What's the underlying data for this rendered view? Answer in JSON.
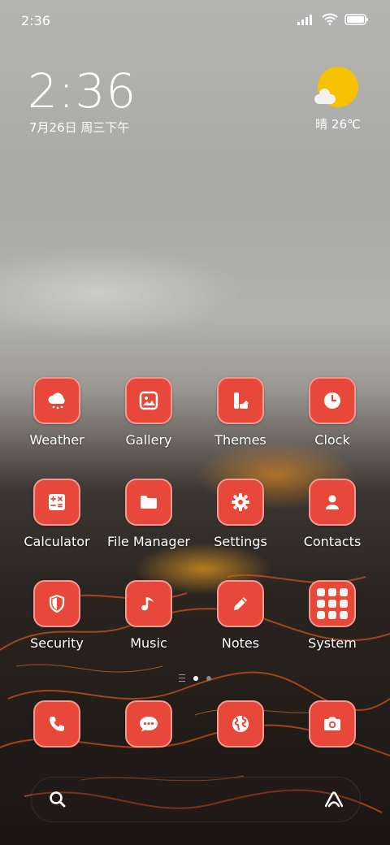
{
  "status_bar": {
    "time": "2:36",
    "icons": [
      "signal-icon",
      "wifi-icon",
      "battery-icon"
    ]
  },
  "clock_widget": {
    "time": "2:36",
    "date": "7月26日 周三下午"
  },
  "weather_widget": {
    "icon": "sun-cloud-icon",
    "text": "晴 26℃"
  },
  "colors": {
    "icon_bg": "#e8483a",
    "icon_border": "#f39a92",
    "sun": "#f6c100"
  },
  "apps": [
    {
      "label": "Weather",
      "icon": "weather-icon"
    },
    {
      "label": "Gallery",
      "icon": "gallery-icon"
    },
    {
      "label": "Themes",
      "icon": "themes-icon"
    },
    {
      "label": "Clock",
      "icon": "clock-icon"
    },
    {
      "label": "Calculator",
      "icon": "calculator-icon"
    },
    {
      "label": "File Manager",
      "icon": "folder-icon"
    },
    {
      "label": "Settings",
      "icon": "gear-icon"
    },
    {
      "label": "Contacts",
      "icon": "contact-icon"
    },
    {
      "label": "Security",
      "icon": "shield-icon"
    },
    {
      "label": "Music",
      "icon": "music-note-icon"
    },
    {
      "label": "Notes",
      "icon": "pencil-icon"
    },
    {
      "label": "System",
      "icon": "folder-grid-icon"
    }
  ],
  "page_indicator": {
    "pages": 2,
    "current": 1
  },
  "dock": [
    {
      "icon": "phone-icon"
    },
    {
      "icon": "chat-bubble-icon"
    },
    {
      "icon": "globe-icon"
    },
    {
      "icon": "camera-icon"
    }
  ],
  "search_bar": {
    "left_icon": "search-icon",
    "right_icon": "assistant-icon"
  }
}
